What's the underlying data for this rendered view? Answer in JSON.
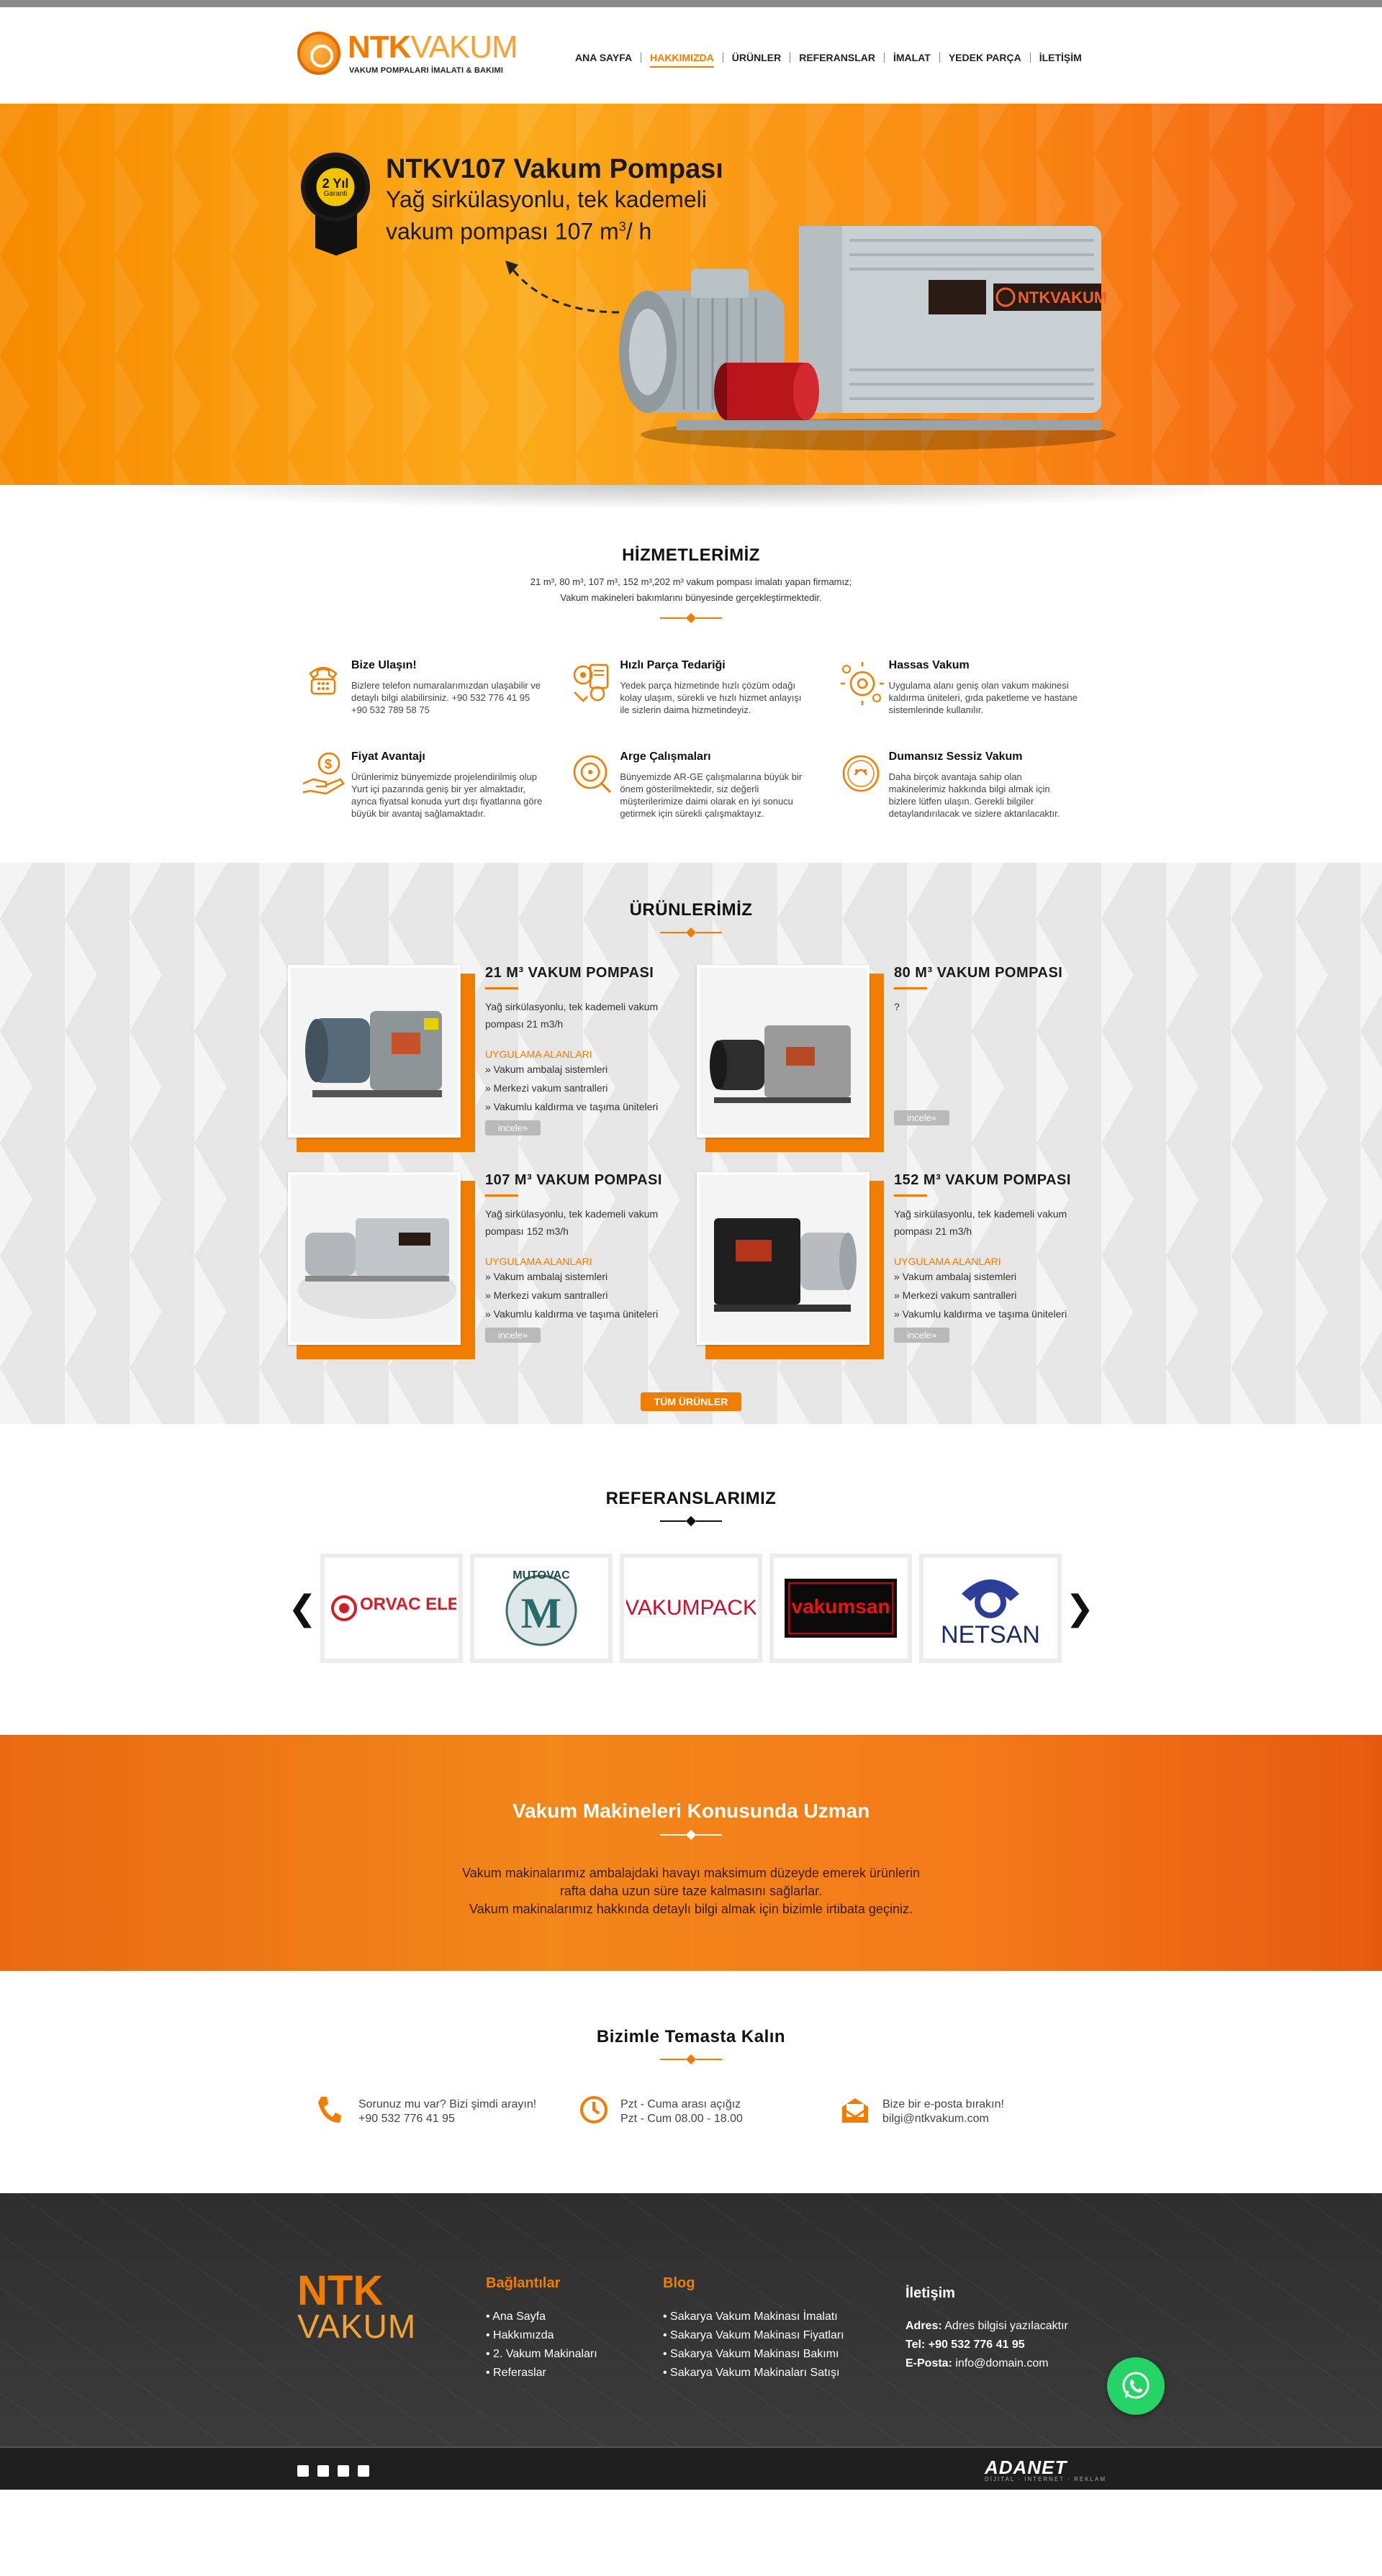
{
  "brand": {
    "name_part1": "NTK",
    "name_part2": "VAKUM",
    "tagline": "VAKUM POMPALARI İMALATI & BAKIMI"
  },
  "nav": {
    "items": [
      {
        "label": "ANA SAYFA",
        "active": false
      },
      {
        "label": "HAKKIMIZDA",
        "active": true
      },
      {
        "label": "ÜRÜNLER",
        "active": false
      },
      {
        "label": "REFERANSLAR",
        "active": false
      },
      {
        "label": "İMALAT",
        "active": false
      },
      {
        "label": "YEDEK PARÇA",
        "active": false
      },
      {
        "label": "İLETİŞİM",
        "active": false
      }
    ]
  },
  "hero": {
    "medal_top": "2 Yıl",
    "medal_bottom": "Garanti",
    "title": "NTKV107 Vakum Pompası",
    "subtitle_line1": "Yağ sirkülasyonlu, tek kademeli",
    "subtitle_line2": "vakum pompası 107 m",
    "subtitle_sup": "3",
    "subtitle_end": "/ h",
    "pump_badge": "NTKVAKUM"
  },
  "services": {
    "title": "HİZMETLERİMİZ",
    "desc_line1": "21 m³, 80 m³, 107 m³, 152 m³,202 m³ vakum pompası imalatı yapan firmamız;",
    "desc_line2": "Vakum makineleri bakımlarını bünyesinde gerçekleştirmektedir.",
    "items": [
      {
        "icon": "phone-icon",
        "title": "Bize Ulaşın!",
        "text": "Bizlere telefon numaralarımızdan ulaşabilir ve detaylı bilgi alabilirsiniz. +90 532 776 41 95 +90 532 789 58 75"
      },
      {
        "icon": "parts-icon",
        "title": "Hızlı Parça Tedariği",
        "text": "Yedek parça hizmetinde hızlı çözüm odağı kolay ulaşım, sürekli ve hızlı hizmet anlayışı ile sizlerin daima hizmetindeyiz."
      },
      {
        "icon": "vacuum-icon",
        "title": "Hassas Vakum",
        "text": "Uygulama alanı geniş olan vakum makinesi kaldırma üniteleri, gıda paketleme ve hastane sistemlerinde kullanılır."
      },
      {
        "icon": "money-hand-icon",
        "title": "Fiyat Avantajı",
        "text": "Ürünlerimiz bünyemizde projelendirilmiş olup Yurt içi pazarında geniş bir yer almaktadır, ayrıca fiyatsal konuda yurt dışı fiyatlarına göre büyük bir avantaj sağlamaktadır."
      },
      {
        "icon": "research-icon",
        "title": "Arge Çalışmaları",
        "text": "Bünyemizde AR-GE çalışmalarına büyük bir önem gösterilmektedir, siz değerli müşterilerimize daimi olarak en iyi sonucu getirmek için sürekli çalışmaktayız."
      },
      {
        "icon": "silent-icon",
        "title": "Dumansız Sessiz Vakum",
        "text": "Daha birçok avantaja sahip olan makinelerimiz hakkında bilgi almak için bizlere lütfen ulaşın. Gerekli bilgiler detaylandırılacak ve sizlere aktarılacaktır."
      }
    ]
  },
  "products": {
    "title": "ÜRÜNLERİMİZ",
    "items": [
      {
        "title": "21 M³ VAKUM POMPASI",
        "desc": "Yağ sirkülasyonlu, tek kademeli vakum pompası 21 m3/h",
        "app_title": "UYGULAMA ALANLARI",
        "apps": [
          "» Vakum ambalaj sistemleri",
          "» Merkezi vakum santralleri",
          "» Vakumlu kaldırma ve taşıma üniteleri"
        ],
        "button": "incele»"
      },
      {
        "title": "80 M³ VAKUM POMPASI",
        "desc": "?",
        "app_title": "",
        "apps": [],
        "button": "incele»"
      },
      {
        "title": "107 M³ VAKUM POMPASI",
        "desc": "Yağ sirkülasyonlu, tek kademeli vakum pompası 152 m3/h",
        "app_title": "UYGULAMA ALANLARI",
        "apps": [
          "» Vakum ambalaj sistemleri",
          "» Merkezi vakum santralleri",
          "» Vakumlu kaldırma ve taşıma üniteleri"
        ],
        "button": "incele»"
      },
      {
        "title": "152 M³ VAKUM POMPASI",
        "desc": "Yağ sirkülasyonlu, tek kademeli vakum pompası 21 m3/h",
        "app_title": "UYGULAMA ALANLARI",
        "apps": [
          "» Vakum ambalaj sistemleri",
          "» Merkezi vakum santralleri",
          "» Vakumlu kaldırma ve taşıma üniteleri"
        ],
        "button": "incele»"
      }
    ],
    "all_button": "TÜM ÜRÜNLER"
  },
  "references": {
    "title": "REFERANSLARIMIZ",
    "prev": "❮",
    "next": "❯",
    "logos": [
      "ORVAC ELECTRONICS",
      "MUTOVAC",
      "VAKUMPACK",
      "vakumsan",
      "NETSAN"
    ]
  },
  "banner": {
    "title": "Vakum Makineleri Konusunda Uzman",
    "line1": "Vakum makinalarımız ambalajdaki havayı maksimum düzeyde emerek ürünlerin",
    "line2": "rafta daha uzun süre taze kalmasını sağlarlar.",
    "line3": "Vakum makinalarımız hakkında detaylı bilgi almak için bizimle irtibata geçiniz."
  },
  "contact": {
    "title": "Bizimle Temasta Kalın",
    "items": [
      {
        "icon": "phone-icon",
        "line1": "Sorunuz mu var? Bizi şimdi arayın!",
        "line2": "+90 532 776 41 95"
      },
      {
        "icon": "clock-icon",
        "line1": "Pzt - Cuma arası açığız",
        "line2": "Pzt - Cum 08.00 - 18.00"
      },
      {
        "icon": "mail-icon",
        "line1": "Bize bir e-posta bırakın!",
        "line2": "bilgi@ntkvakum.com"
      }
    ]
  },
  "footer": {
    "logo_line1": "NTK",
    "logo_line2": "VAKUM",
    "links_title": "Bağlantılar",
    "links": [
      "• Ana Sayfa",
      "• Hakkımızda",
      "• 2. Vakum Makinaları",
      "• Referaslar"
    ],
    "blog_title": "Blog",
    "blog": [
      "• Sakarya Vakum Makinası İmalatı",
      "• Sakarya Vakum Makinası Fiyatları",
      "• Sakarya Vakum Makinası Bakımı",
      "• Sakarya Vakum Makinaları Satışı"
    ],
    "contact_title": "İletişim",
    "address_label": "Adres:",
    "address_value": "Adres bilgisi yazılacaktır",
    "phone_label": "Tel:",
    "phone_value": "+90 532 776 41 95",
    "email_label": "E-Posta:",
    "email_value": "info@domain.com",
    "agency": "ADANET",
    "agency_sub": "DİJİTAL · İNTERNET · REKLAM"
  },
  "colors": {
    "accent": "#f07d00",
    "whatsapp": "#25d366"
  }
}
